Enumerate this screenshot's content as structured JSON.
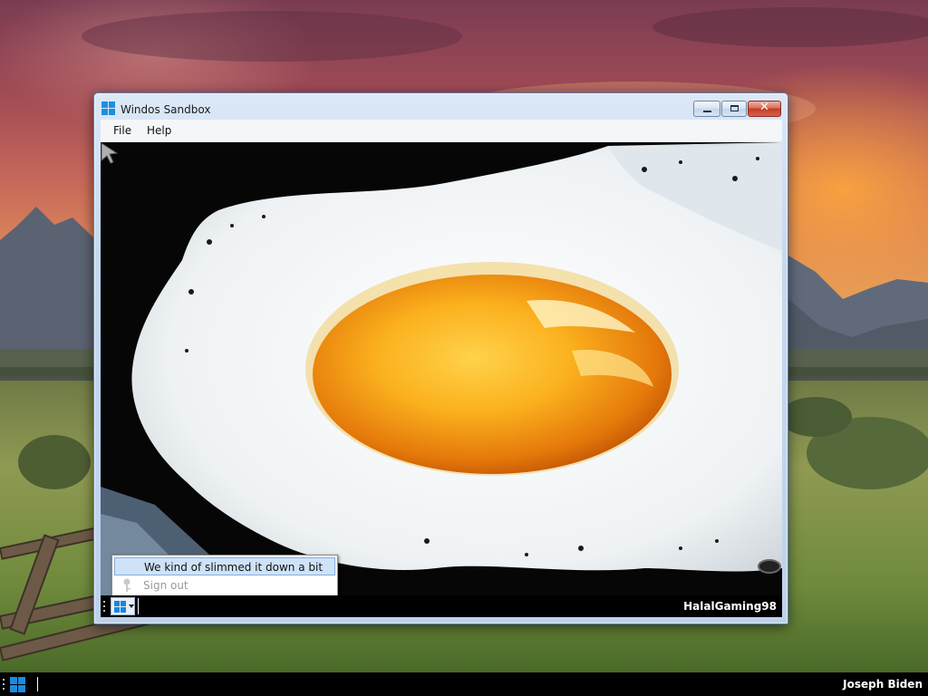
{
  "desktop": {
    "wallpaper": "sunset-mountain-meadow",
    "taskbar": {
      "start_icon": "windows-logo-icon",
      "user_name": "Joseph Biden"
    }
  },
  "window": {
    "title": "Windos Sandbox",
    "icon": "windows-logo-icon",
    "controls": {
      "minimize": "minimize-icon",
      "maximize": "maximize-icon",
      "close_label": "✕"
    },
    "menu": [
      {
        "label": "File"
      },
      {
        "label": "Help"
      }
    ],
    "content": {
      "image": "fried-egg",
      "inner_taskbar": {
        "start_icon": "windows-logo-icon",
        "user_name": "HalalGaming98"
      },
      "popup_menu": {
        "items": [
          {
            "label": "We kind of slimmed it down a bit",
            "state": "highlighted"
          },
          {
            "label": "Sign out",
            "state": "disabled",
            "icon": "key-icon"
          }
        ]
      }
    }
  },
  "colors": {
    "accent": "#1a8ce0",
    "highlight": "#cfe3f7",
    "close_button": "#c23c22"
  }
}
